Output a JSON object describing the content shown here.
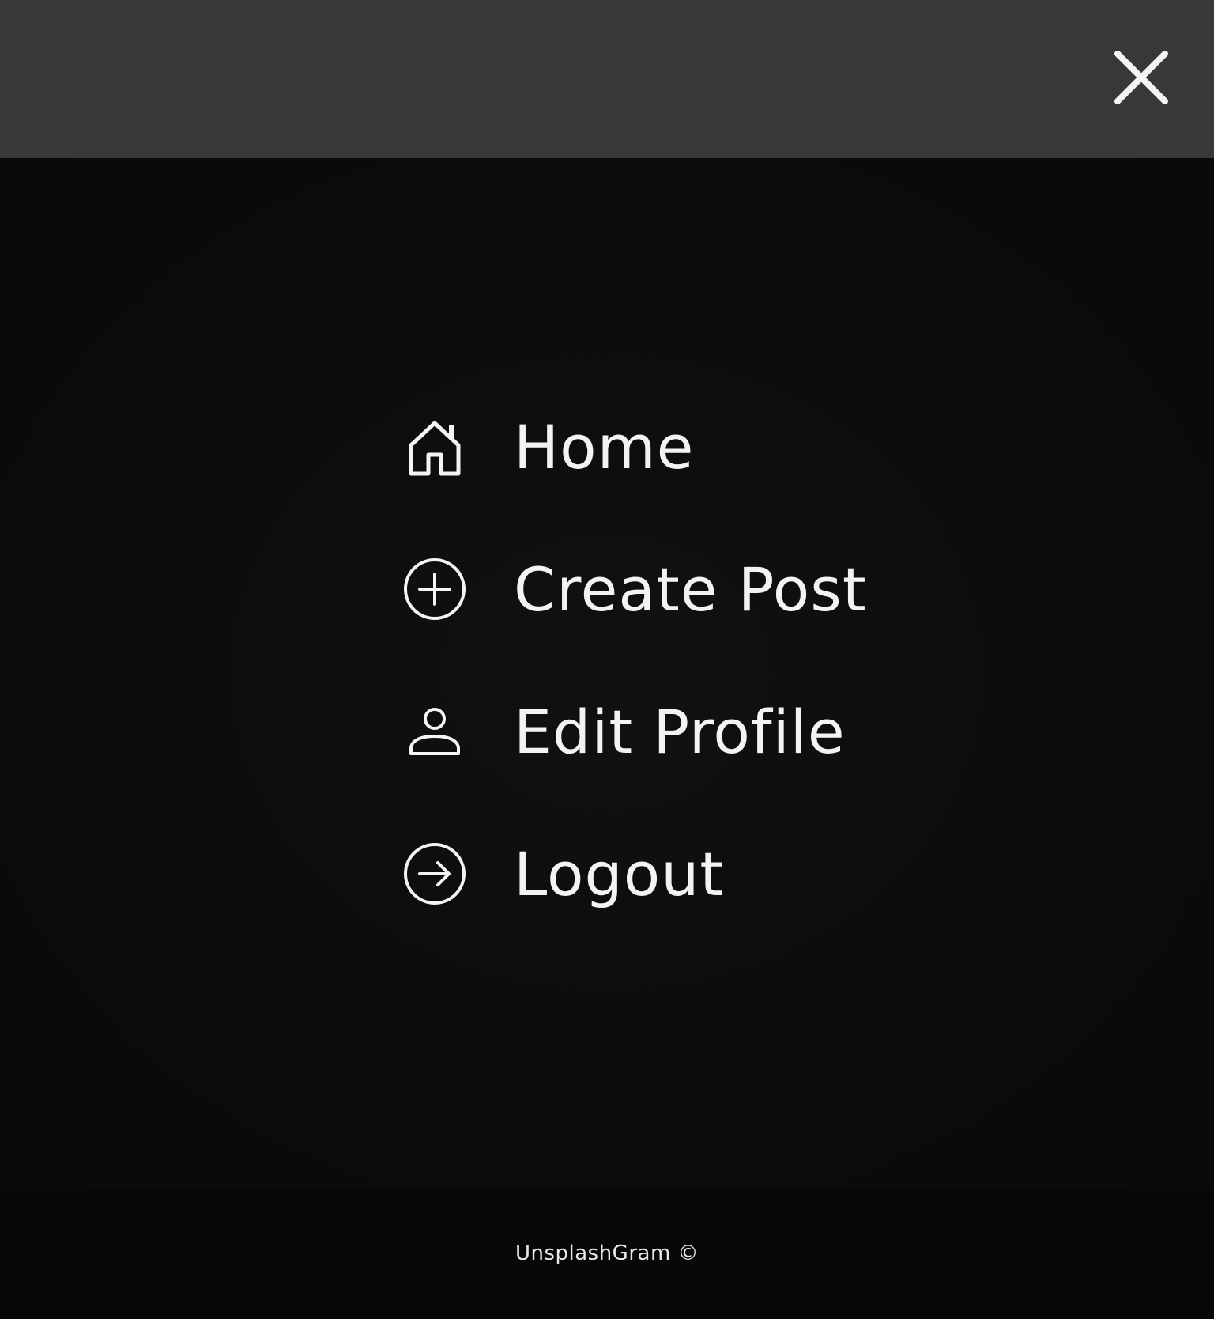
{
  "header": {
    "close_icon": "close-icon"
  },
  "menu": {
    "items": [
      {
        "label": "Home",
        "icon": "home-icon"
      },
      {
        "label": "Create Post",
        "icon": "plus-circle-icon"
      },
      {
        "label": "Edit Profile",
        "icon": "user-icon"
      },
      {
        "label": "Logout",
        "icon": "arrow-right-circle-icon"
      }
    ]
  },
  "footer": {
    "text": "UnsplashGram ©"
  },
  "colors": {
    "topbar": "#393837",
    "background": "#0c0c0c",
    "text": "#f3f3f3"
  }
}
